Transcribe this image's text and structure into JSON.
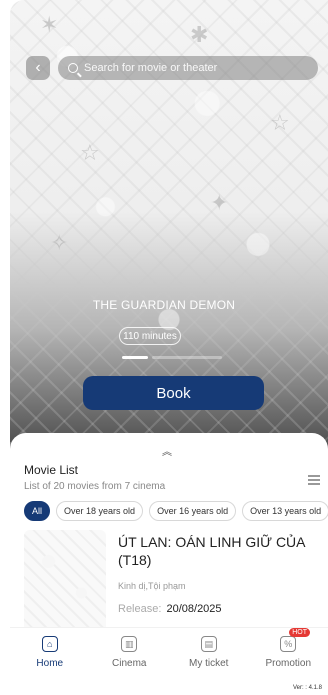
{
  "search": {
    "placeholder": "Search for movie or theater"
  },
  "hero": {
    "title": "THE GUARDIAN DEMON",
    "duration": "110 minutes",
    "book_label": "Book"
  },
  "movie_list": {
    "title": "Movie List",
    "subtitle": "List of 20 movies from 7 cinema",
    "filters": [
      "All",
      "Over 18 years old",
      "Over 16 years old",
      "Over 13 years old"
    ],
    "active_filter": "All"
  },
  "movie": {
    "name": "ÚT LAN: OÁN LINH GIỮ CỦA (T18)",
    "genre": "Kinh dị,Tội phạm",
    "release_label": "Release:",
    "release_date": "20/08/2025"
  },
  "nav": {
    "items": [
      {
        "label": "Home",
        "icon": "home-icon",
        "active": true
      },
      {
        "label": "Cinema",
        "icon": "cinema-icon",
        "active": false
      },
      {
        "label": "My ticket",
        "icon": "ticket-icon",
        "active": false
      },
      {
        "label": "Promotion",
        "icon": "promotion-icon",
        "active": false
      }
    ],
    "promotion_badge": "HOT"
  },
  "version": "Ver: : 4.1.8",
  "colors": {
    "primary": "#163a76",
    "badge": "#e53935"
  }
}
